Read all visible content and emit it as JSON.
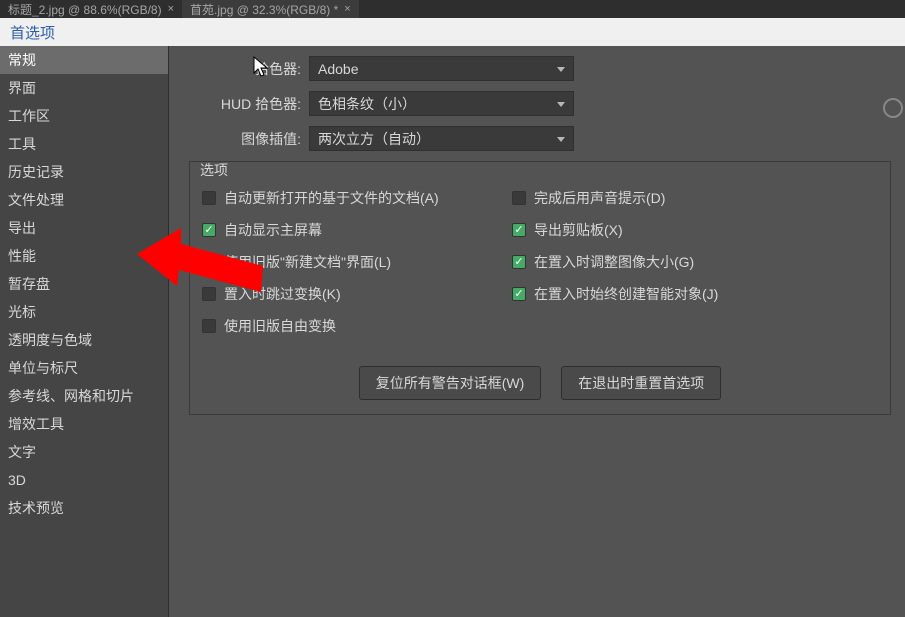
{
  "tabs": [
    {
      "label": "标题_2.jpg @ 88.6%(RGB/8)"
    },
    {
      "label": "苜苑.jpg @ 32.3%(RGB/8) *"
    }
  ],
  "dialog": {
    "title": "首选项"
  },
  "sidebar": {
    "items": [
      "常规",
      "界面",
      "工作区",
      "工具",
      "历史记录",
      "文件处理",
      "导出",
      "性能",
      "暂存盘",
      "光标",
      "透明度与色域",
      "单位与标尺",
      "参考线、网格和切片",
      "增效工具",
      "文字",
      "3D",
      "技术预览"
    ],
    "selected": 0
  },
  "fields": {
    "colorPicker": {
      "label": "拾色器:",
      "value": "Adobe"
    },
    "hudColorPicker": {
      "label": "HUD 拾色器:",
      "value": "色相条纹（小）"
    },
    "imageInterp": {
      "label": "图像插值:",
      "value": "两次立方（自动）"
    }
  },
  "options": {
    "legend": "选项",
    "left": [
      {
        "label": "自动更新打开的基于文件的文档(A)",
        "checked": false
      },
      {
        "label": "自动显示主屏幕",
        "checked": true
      },
      {
        "label": "使用旧版\"新建文档\"界面(L)",
        "checked": false
      },
      {
        "label": "置入时跳过变换(K)",
        "checked": false
      },
      {
        "label": "使用旧版自由变换",
        "checked": false
      }
    ],
    "right": [
      {
        "label": "完成后用声音提示(D)",
        "checked": false
      },
      {
        "label": "导出剪贴板(X)",
        "checked": true
      },
      {
        "label": "在置入时调整图像大小(G)",
        "checked": true
      },
      {
        "label": "在置入时始终创建智能对象(J)",
        "checked": true
      }
    ]
  },
  "buttons": {
    "resetWarnings": "复位所有警告对话框(W)",
    "resetOnExit": "在退出时重置首选项"
  }
}
